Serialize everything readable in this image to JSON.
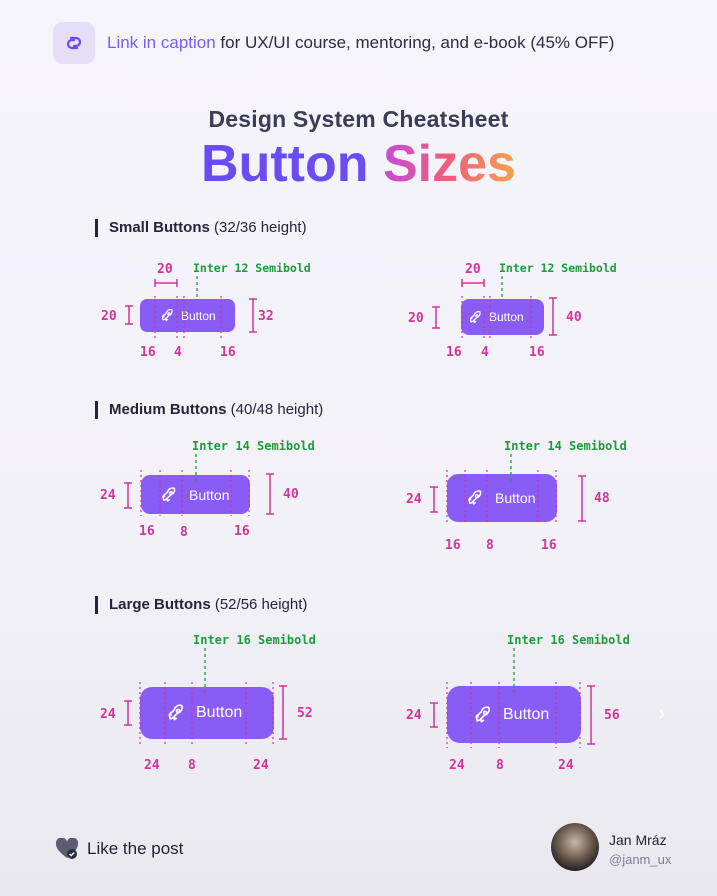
{
  "banner": {
    "link_text": "Link in caption",
    "rest_text": " for UX/UI course, mentoring, and e-book (45% OFF)"
  },
  "header": {
    "subtitle": "Design System Cheatsheet",
    "title_word1": "Button",
    "title_word2": "Sizes"
  },
  "sections": [
    {
      "title": "Small Buttons",
      "note": "(32/36 height)"
    },
    {
      "title": "Medium Buttons",
      "note": "(40/48 height)"
    },
    {
      "title": "Large Buttons",
      "note": "(52/56 height)"
    }
  ],
  "button_label": "Button",
  "fonts": {
    "small": "Inter 12 Semibold",
    "medium": "Inter 14 Semibold",
    "large": "Inter 16 Semibold"
  },
  "measurements": {
    "small_a": {
      "icon": "20",
      "gap_top": "20",
      "height": "32",
      "pad_left": "16",
      "gap": "4",
      "pad_right": "16"
    },
    "small_b": {
      "icon": "20",
      "gap_top": "20",
      "height": "40",
      "pad_left": "16",
      "gap": "4",
      "pad_right": "16"
    },
    "medium_a": {
      "icon": "24",
      "height": "40",
      "pad_left": "16",
      "gap": "8",
      "pad_right": "16"
    },
    "medium_b": {
      "icon": "24",
      "height": "48",
      "pad_left": "16",
      "gap": "8",
      "pad_right": "16"
    },
    "large_a": {
      "icon": "24",
      "height": "52",
      "pad_left": "24",
      "gap": "8",
      "pad_right": "24"
    },
    "large_b": {
      "icon": "24",
      "height": "56",
      "pad_left": "24",
      "gap": "8",
      "pad_right": "24"
    }
  },
  "footer": {
    "like_text": "Like the post",
    "author_name": "Jan Mráz",
    "author_handle": "@janm_ux"
  },
  "colors": {
    "button": "#8a5cf6",
    "measure": "#d0359a",
    "annotation": "#1f9b3b",
    "accent": "#7a5cf0"
  },
  "icons": {
    "banner": "link-icon",
    "button": "rocket-icon",
    "like": "heart-check-icon",
    "next": "chevron-right-icon"
  }
}
